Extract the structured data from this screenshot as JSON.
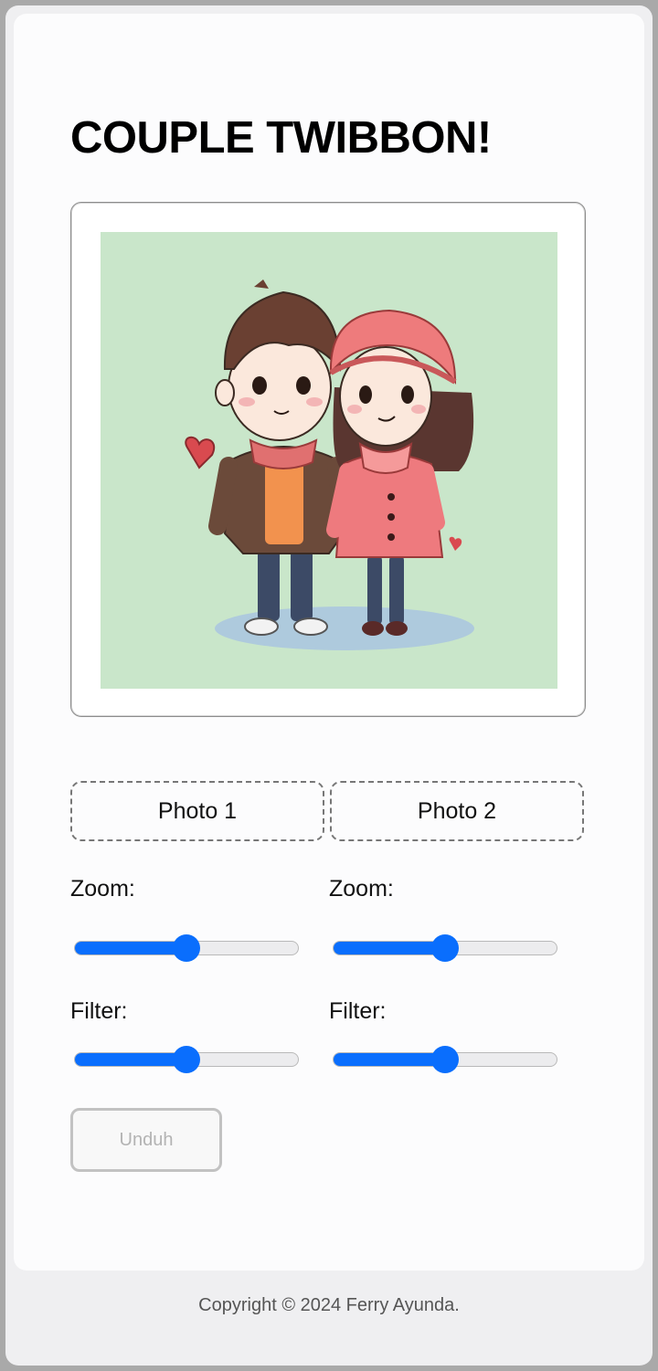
{
  "header": {
    "title": "COUPLE TWIBBON!"
  },
  "preview": {
    "image": "couple-illustration"
  },
  "photo1": {
    "label": "Photo 1"
  },
  "photo2": {
    "label": "Photo 2"
  },
  "controls": {
    "left": {
      "zoom_label": "Zoom:",
      "zoom_value": 0.5,
      "filter_label": "Filter:",
      "filter_value": 0.5
    },
    "right": {
      "zoom_label": "Zoom:",
      "zoom_value": 0.5,
      "filter_label": "Filter:",
      "filter_value": 0.5
    }
  },
  "actions": {
    "download_label": "Unduh"
  },
  "footer": {
    "copyright": "Copyright © 2024 Ferry Ayunda."
  },
  "colors": {
    "accent": "#0a6efd",
    "preview_bg": "#c9e6ca"
  }
}
